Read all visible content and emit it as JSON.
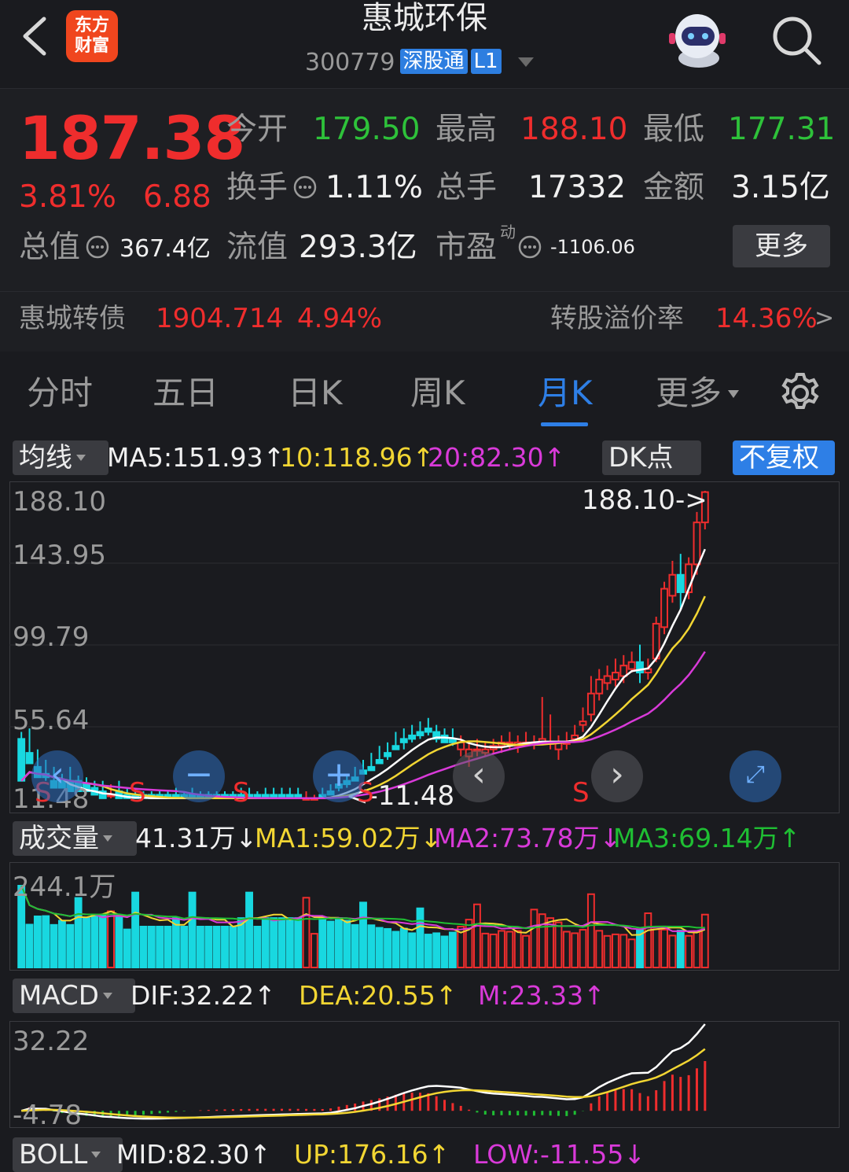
{
  "header": {
    "back_icon": "chevron-left-icon",
    "logo_text_top": "东方",
    "logo_text_bottom": "财富",
    "stock_name": "惠城环保",
    "stock_code": "300779",
    "tag_connect": "深股通",
    "tag_level": "L1",
    "robot_icon": "robot-avatar-icon",
    "search_icon": "search-icon"
  },
  "quote": {
    "price": "187.38",
    "change_pct": "3.81%",
    "change_amt": "6.88",
    "open_label": "今开",
    "open_value": "179.50",
    "high_label": "最高",
    "high_value": "188.10",
    "low_label": "最低",
    "low_value": "177.31",
    "turnover_label": "换手",
    "turnover_value": "1.11%",
    "volume_label": "总手",
    "volume_value": "17332",
    "amount_label": "金额",
    "amount_value": "3.15亿",
    "mcap_label": "总值",
    "mcap_value": "367.4亿",
    "float_label": "流值",
    "float_value": "293.3亿",
    "pe_label": "市盈",
    "pe_sup": "动",
    "pe_value": "-1106.06",
    "more_label": "更多",
    "bond_name": "惠城转债",
    "bond_price": "1904.714",
    "bond_pct": "4.94%",
    "premium_label": "转股溢价率",
    "premium_value": "14.36%",
    "premium_arrow": ">"
  },
  "tabs": [
    {
      "label": "分时"
    },
    {
      "label": "五日"
    },
    {
      "label": "日K"
    },
    {
      "label": "周K"
    },
    {
      "label": "月K",
      "active": true
    },
    {
      "label": "更多"
    }
  ],
  "settings_icon": "gear-icon",
  "kline": {
    "indicator_select": "均线",
    "ma5": "MA5:151.93↑",
    "ma10": "10:118.96↑",
    "ma20": "20:82.30↑",
    "dk_select": "DK点",
    "adjust_button": "不复权",
    "axis": [
      "188.10",
      "143.95",
      "99.79",
      "55.64",
      "11.48"
    ],
    "max_marker": "188.10->",
    "min_marker": "<-11.48",
    "signal_label": "S"
  },
  "volume": {
    "indicator_select": "成交量",
    "vol": "41.31万↓",
    "ma1": "MA1:59.02万↓",
    "ma2": "MA2:73.78万↓",
    "ma3": "MA3:69.14万↑",
    "axis_top": "244.1万"
  },
  "macd": {
    "indicator_select": "MACD",
    "dif": "DIF:32.22↑",
    "dea": "DEA:20.55↑",
    "m": "M:23.33↑",
    "axis_top": "32.22",
    "axis_bottom": "-4.78"
  },
  "boll": {
    "indicator_select": "BOLL",
    "mid": "MID:82.30↑",
    "up": "UP:176.16↑",
    "low": "LOW:-11.55↓"
  },
  "nav_controls": {
    "left_icon": "chevron-left-icon",
    "zoom_out_icon": "minus-icon",
    "zoom_in_icon": "plus-icon",
    "prev_icon": "chevron-left-icon",
    "next_icon": "chevron-right-icon",
    "fullscreen_icon": "expand-icon"
  },
  "chart_data": {
    "type": "candlestick",
    "period": "monthly",
    "ylim": [
      11.48,
      188.1
    ],
    "candles": [
      [
        46,
        50,
        30,
        22
      ],
      [
        38,
        52,
        38,
        32
      ],
      [
        30,
        40,
        26,
        24
      ],
      [
        26,
        34,
        22,
        24
      ],
      [
        22,
        30,
        22,
        18
      ],
      [
        22,
        26,
        18,
        18
      ],
      [
        22,
        30,
        22,
        16
      ],
      [
        22,
        25,
        18,
        16
      ],
      [
        20,
        24,
        16,
        16
      ],
      [
        18,
        22,
        14,
        14
      ],
      [
        16,
        22,
        14,
        12
      ],
      [
        14,
        20,
        12,
        14
      ],
      [
        16,
        22,
        14,
        12
      ],
      [
        14,
        18,
        14,
        12
      ],
      [
        14,
        18,
        12,
        12
      ],
      [
        14,
        16,
        12,
        12
      ],
      [
        14,
        16,
        12,
        12
      ],
      [
        14,
        16,
        12,
        12
      ],
      [
        14,
        16,
        12,
        12
      ],
      [
        14,
        18,
        12,
        12
      ],
      [
        14,
        16,
        12,
        12
      ],
      [
        14,
        18,
        12,
        12
      ],
      [
        14,
        16,
        12,
        12
      ],
      [
        14,
        16,
        12,
        12
      ],
      [
        14,
        16,
        12,
        12
      ],
      [
        14,
        16,
        12,
        12
      ],
      [
        14,
        16,
        12,
        12
      ],
      [
        14,
        18,
        12,
        12
      ],
      [
        14,
        18,
        12,
        12
      ],
      [
        14,
        16,
        12,
        12
      ],
      [
        14,
        18,
        12,
        12
      ],
      [
        14,
        18,
        12,
        12
      ],
      [
        14,
        18,
        12,
        12
      ],
      [
        14,
        18,
        12,
        12
      ],
      [
        14,
        18,
        12,
        12
      ],
      [
        12,
        16,
        11.48,
        12
      ],
      [
        12,
        14,
        11.48,
        12
      ],
      [
        14,
        18,
        12,
        12
      ],
      [
        16,
        20,
        14,
        14
      ],
      [
        20,
        24,
        16,
        18
      ],
      [
        22,
        26,
        18,
        20
      ],
      [
        24,
        30,
        22,
        22
      ],
      [
        28,
        34,
        26,
        26
      ],
      [
        30,
        38,
        28,
        28
      ],
      [
        34,
        42,
        32,
        32
      ],
      [
        38,
        44,
        34,
        36
      ],
      [
        42,
        50,
        40,
        40
      ],
      [
        46,
        52,
        40,
        44
      ],
      [
        48,
        54,
        44,
        46
      ],
      [
        50,
        56,
        46,
        48
      ],
      [
        52,
        58,
        48,
        50
      ],
      [
        50,
        54,
        44,
        46
      ],
      [
        48,
        52,
        44,
        44
      ],
      [
        46,
        52,
        42,
        44
      ],
      [
        40,
        48,
        36,
        44
      ],
      [
        36,
        44,
        30,
        40
      ],
      [
        40,
        46,
        36,
        40
      ],
      [
        38,
        44,
        36,
        40
      ],
      [
        40,
        46,
        38,
        42
      ],
      [
        42,
        48,
        38,
        44
      ],
      [
        44,
        50,
        40,
        44
      ],
      [
        42,
        48,
        38,
        44
      ],
      [
        44,
        50,
        42,
        44
      ],
      [
        44,
        48,
        40,
        44
      ],
      [
        44,
        70,
        44,
        46
      ],
      [
        44,
        60,
        40,
        44
      ],
      [
        40,
        48,
        34,
        44
      ],
      [
        44,
        50,
        40,
        44
      ],
      [
        46,
        54,
        44,
        48
      ],
      [
        54,
        64,
        50,
        56
      ],
      [
        60,
        82,
        56,
        72
      ],
      [
        72,
        86,
        68,
        80
      ],
      [
        78,
        88,
        74,
        82
      ],
      [
        80,
        92,
        76,
        84
      ],
      [
        82,
        94,
        78,
        88
      ],
      [
        86,
        96,
        84,
        90
      ],
      [
        90,
        100,
        78,
        84
      ],
      [
        84,
        92,
        80,
        86
      ],
      [
        92,
        116,
        90,
        112
      ],
      [
        110,
        136,
        106,
        132
      ],
      [
        128,
        148,
        124,
        140
      ],
      [
        140,
        152,
        120,
        130
      ],
      [
        130,
        150,
        126,
        146
      ],
      [
        146,
        176,
        140,
        170
      ],
      [
        170,
        188.1,
        166,
        187.38
      ]
    ],
    "candle_fields": [
      "open",
      "high",
      "low",
      "close"
    ]
  }
}
